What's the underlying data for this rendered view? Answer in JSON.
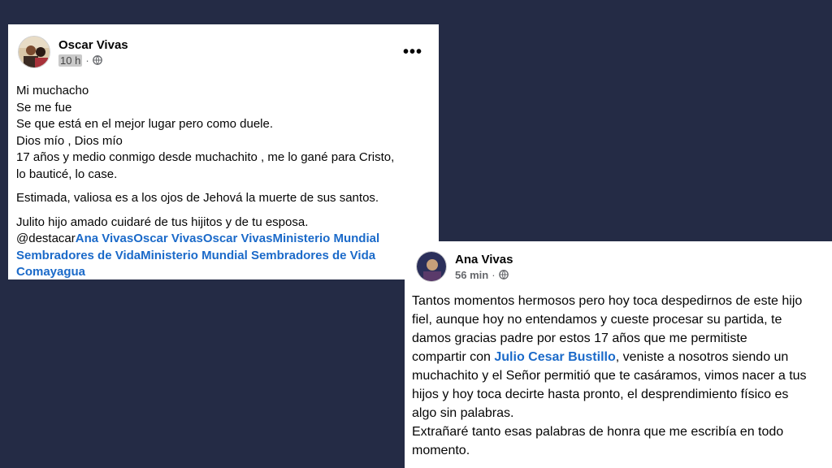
{
  "post1": {
    "author": "Oscar Vivas",
    "time": "10 h",
    "separator": "·",
    "more_label": "•••",
    "lines": [
      "Mi muchacho",
      "Se me fue",
      "Se que está en el mejor lugar pero como duele.",
      "Dios mío , Dios mío",
      "17 años y medio conmigo desde muchachito , me lo gané para Cristo,",
      "lo bauticé, lo case."
    ],
    "line7": "Estimada, valiosa es a los ojos de Jehová la muerte de sus santos.",
    "line8": "Julito hijo amado cuidaré de tus hijitos y de tu esposa.",
    "tag_prefix": "@destacar",
    "tag_line1_links": "Ana VivasOscar VivasOscar VivasMinisterio Mundial",
    "tag_line2_links": "Sembradores de VidaMinisterio Mundial Sembradores de Vida",
    "tag_line3_links": "Comayagua"
  },
  "post2": {
    "author": "Ana Vivas",
    "time": "56 min",
    "separator": "·",
    "lines": [
      "Tantos momentos hermosos pero hoy toca despedirnos de este hijo",
      "fiel, aunque hoy no entendamos y cueste procesar su partida, te",
      "damos gracias padre por estos 17 años que me permitiste"
    ],
    "line4_prefix": "compartir con ",
    "line4_link": "Julio Cesar Bustillo",
    "line4_suffix": ", veniste a nosotros siendo un",
    "lines_after": [
      "muchachito y el Señor permitió que te casáramos, vimos nacer a tus",
      "hijos y hoy toca decirte hasta pronto, el desprendimiento físico es",
      "algo sin palabras.",
      "Extrañaré tanto esas palabras de honra que me escribía en todo",
      "momento."
    ]
  },
  "colors": {
    "background": "#242b45",
    "link": "#1b6ac9",
    "meta": "#65676b"
  }
}
